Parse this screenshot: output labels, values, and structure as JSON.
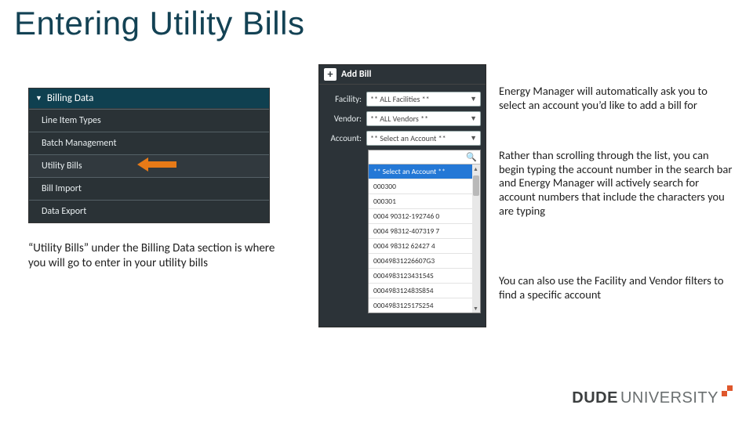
{
  "title": "Entering Utility Bills",
  "sidebar": {
    "header": "Billing Data",
    "items": [
      "Line Item Types",
      "Batch Management",
      "Utility Bills",
      "Bill Import",
      "Data Export"
    ],
    "highlight_index": 2
  },
  "caption_left": "“Utility Bills” under the Billing Data section is where you will go to enter in your utility bills",
  "addbill": {
    "button": "Add Bill",
    "facility_label": "Facility:",
    "facility_value": "** ALL Facilities **",
    "vendor_label": "Vendor:",
    "vendor_value": "** ALL Vendors **",
    "account_label": "Account:",
    "account_value": "** Select an Account **",
    "dropdown": {
      "selected": "** Select an Account **",
      "options": [
        "000300",
        "000301",
        "0004 90312-192746 0",
        "0004 98312-407319 7",
        "0004 98312 62427 4",
        "00049831226607G3",
        "000498312343154S",
        "000498312483S854",
        "000498312517S254"
      ]
    }
  },
  "paras": {
    "p1": "Energy Manager will automatically ask you to select an account you’d like to add a bill for",
    "p2": "Rather than scrolling through the list, you can begin typing the account number in the search bar and Energy Manager will actively search for account numbers that include the characters you are typing",
    "p3": "You can also use the Facility and Vendor filters to find a specific account"
  },
  "footer": {
    "brand1": "DUDE",
    "brand2": "UNIVERSITY"
  }
}
